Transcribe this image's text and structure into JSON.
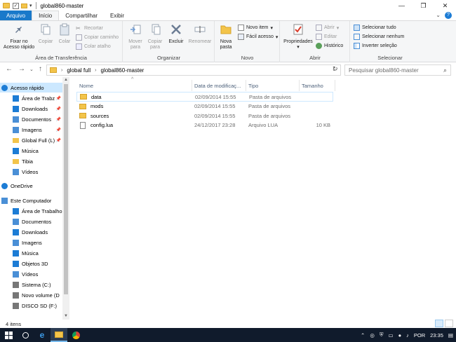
{
  "window": {
    "title": "global860-master",
    "min": "—",
    "max": "❐",
    "close": "✕"
  },
  "tabs": {
    "file": "Arquivo",
    "home": "Início",
    "share": "Compartilhar",
    "view": "Exibir"
  },
  "ribbon": {
    "clipboard": {
      "label": "Área de Transferência",
      "pin": "Fixar no\nAcesso rápido",
      "copy": "Copiar",
      "paste": "Colar",
      "cut": "Recortar",
      "copy_path": "Copiar caminho",
      "paste_shortcut": "Colar atalho"
    },
    "organize": {
      "label": "Organizar",
      "move": "Mover\npara",
      "copy_to": "Copiar\npara",
      "delete": "Excluir",
      "rename": "Renomear"
    },
    "new": {
      "label": "Novo",
      "new_folder": "Nova\npasta",
      "new_item": "Novo item",
      "easy_access": "Fácil acesso"
    },
    "open": {
      "label": "Abrir",
      "properties": "Propriedades",
      "open": "Abrir",
      "edit": "Editar",
      "history": "Histórico"
    },
    "select": {
      "label": "Selecionar",
      "select_all": "Selecionar tudo",
      "select_none": "Selecionar nenhum",
      "invert": "Inverter seleção"
    }
  },
  "address": {
    "crumbs": [
      "global full",
      "global860-master"
    ],
    "search_placeholder": "Pesquisar global860-master"
  },
  "nav": {
    "items": [
      {
        "label": "Acesso rápido",
        "icon": "star-icon",
        "color": "#1c7cd5"
      },
      {
        "label": "Área de Trabz",
        "icon": "desktop-icon",
        "color": "#1c7cd5",
        "pinned": true
      },
      {
        "label": "Downloads",
        "icon": "download-icon",
        "color": "#1c7cd5",
        "pinned": true
      },
      {
        "label": "Documentos",
        "icon": "documents-icon",
        "color": "#4a8fd6",
        "pinned": true
      },
      {
        "label": "Imagens",
        "icon": "images-icon",
        "color": "#4a8fd6",
        "pinned": true
      },
      {
        "label": "Global Full (L)",
        "icon": "folder-icon",
        "color": "#f3c44a",
        "pinned": true
      },
      {
        "label": "Música",
        "icon": "music-icon",
        "color": "#1c7cd5"
      },
      {
        "label": "Tibia",
        "icon": "folder-icon",
        "color": "#f3c44a"
      },
      {
        "label": "Vídeos",
        "icon": "videos-icon",
        "color": "#4a8fd6"
      },
      {
        "label": "OneDrive",
        "icon": "cloud-icon",
        "color": "#1c7cd5"
      },
      {
        "label": "Este Computador",
        "icon": "computer-icon",
        "color": "#4a8fd6"
      },
      {
        "label": "Área de Trabalho",
        "icon": "desktop-icon",
        "color": "#1c7cd5"
      },
      {
        "label": "Documentos",
        "icon": "documents-icon",
        "color": "#4a8fd6"
      },
      {
        "label": "Downloads",
        "icon": "download-icon",
        "color": "#1c7cd5"
      },
      {
        "label": "Imagens",
        "icon": "images-icon",
        "color": "#4a8fd6"
      },
      {
        "label": "Música",
        "icon": "music-icon",
        "color": "#1c7cd5"
      },
      {
        "label": "Objetos 3D",
        "icon": "cube-icon",
        "color": "#1c7cd5"
      },
      {
        "label": "Vídeos",
        "icon": "videos-icon",
        "color": "#4a8fd6"
      },
      {
        "label": "Sistema (C:)",
        "icon": "drive-icon",
        "color": "#777777"
      },
      {
        "label": "Novo volume (D",
        "icon": "drive-icon",
        "color": "#777777"
      },
      {
        "label": "DISCO SD (F:)",
        "icon": "drive-icon",
        "color": "#777777"
      }
    ]
  },
  "columns": {
    "name": "Nome",
    "date": "Data de modificaç...",
    "type": "Tipo",
    "size": "Tamanho"
  },
  "files": [
    {
      "name": "data",
      "date": "02/09/2014 15:55",
      "type": "Pasta de arquivos",
      "size": "",
      "kind": "folder"
    },
    {
      "name": "mods",
      "date": "02/09/2014 15:55",
      "type": "Pasta de arquivos",
      "size": "",
      "kind": "folder"
    },
    {
      "name": "sources",
      "date": "02/09/2014 15:55",
      "type": "Pasta de arquivos",
      "size": "",
      "kind": "folder"
    },
    {
      "name": "config.lua",
      "date": "24/12/2017 23:28",
      "type": "Arquivo LUA",
      "size": "10 KB",
      "kind": "file"
    }
  ],
  "status": {
    "count": "4 itens"
  },
  "taskbar": {
    "lang": "POR",
    "time": "23:35"
  }
}
